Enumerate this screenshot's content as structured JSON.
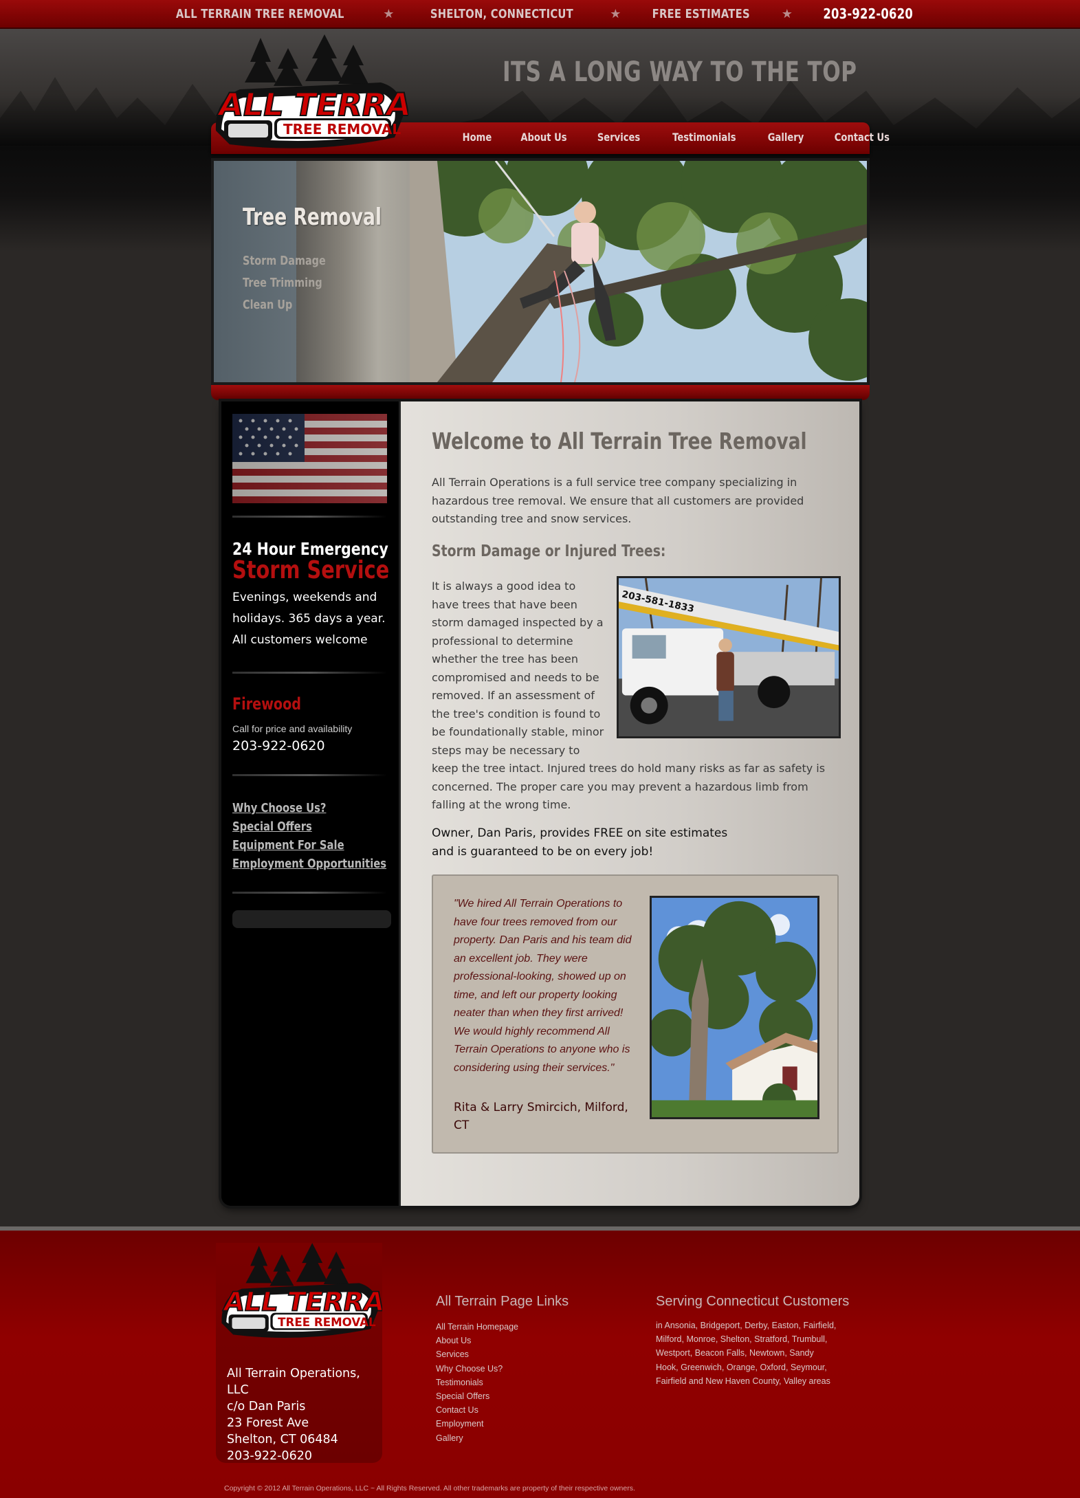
{
  "topbar": {
    "company": "ALL TERRAIN TREE REMOVAL",
    "location": "SHELTON, CONNECTICUT",
    "offer": "FREE ESTIMATES",
    "phone": "203-922-0620",
    "separator": "★"
  },
  "header": {
    "tagline": "ITS A LONG WAY TO THE TOP",
    "logo": {
      "line1": "ALL TERRAIN",
      "line2": "TREE REMOVAL"
    }
  },
  "nav": {
    "items": [
      {
        "label": "Home"
      },
      {
        "label": "About Us"
      },
      {
        "label": "Services"
      },
      {
        "label": "Testimonials"
      },
      {
        "label": "Gallery"
      },
      {
        "label": "Contact Us"
      }
    ]
  },
  "hero": {
    "title": "Tree Removal",
    "list": [
      "Storm Damage",
      "Tree Trimming",
      "Clean Up"
    ]
  },
  "sidebar": {
    "emergency_line1": "24 Hour Emergency",
    "emergency_line2": "Storm Service",
    "emergency_text": "Evenings, weekends and holidays. 365 days a year. All customers welcome",
    "firewood_title": "Firewood",
    "firewood_sub": "Call for price and availability",
    "firewood_phone": "203-922-0620",
    "links": [
      {
        "label": "Why Choose Us?"
      },
      {
        "label": "Special Offers"
      },
      {
        "label": "Equipment For Sale"
      },
      {
        "label": "Employment Opportunities"
      }
    ]
  },
  "content": {
    "welcome": "Welcome to All Terrain Tree Removal",
    "intro": "All Terrain Operations is a full service tree company specializing in hazardous tree removal. We ensure that all customers are provided outstanding tree and snow services.",
    "storm_title": "Storm Damage or Injured Trees:",
    "storm_text": "It is always a good idea to have trees that have been storm damaged inspected by a professional to determine whether the tree has been compromised and needs to be removed. If an assessment of the tree's condition is found to be foundationally stable, minor steps may be necessary to keep the tree intact. Injured trees do hold many risks as far as safety is concerned. The proper care you may prevent a hazardous limb from falling at the wrong time.",
    "truck_phone_text": "203-581-1833",
    "owner_line1": "Owner, Dan Paris, provides FREE on site estimates",
    "owner_line2": "and is guaranteed to be on every job!",
    "testimonial_quote": "\"We hired All Terrain Operations to have four trees removed from our property. Dan Paris and his team did an excellent job. They were professional-looking, showed up on time, and left our property looking neater than when they first arrived! We would highly recommend All Terrain Operations to anyone who is considering using their services.\"",
    "testimonial_author": "Rita & Larry Smircich, Milford, CT"
  },
  "footer": {
    "address": [
      "All Terrain Operations, LLC",
      "c/o Dan Paris",
      "23 Forest Ave",
      "Shelton, CT 06484",
      "203-922-0620"
    ],
    "links_title": "All Terrain Page Links",
    "links": [
      {
        "label": "All Terrain Homepage"
      },
      {
        "label": "About Us"
      },
      {
        "label": "Services"
      },
      {
        "label": "Why Choose Us?"
      },
      {
        "label": "Testimonials"
      },
      {
        "label": "Special Offers"
      },
      {
        "label": "Contact Us"
      },
      {
        "label": "Employment"
      },
      {
        "label": "Gallery"
      }
    ],
    "serving_title": "Serving Connecticut Customers",
    "serving_text": "in Ansonia, Bridgeport, Derby, Easton, Fairfield, Milford, Monroe, Shelton, Stratford, Trumbull, Westport, Beacon Falls, Newtown, Sandy Hook, Greenwich, Orange, Oxford, Seymour, Fairfield and New Haven County, Valley areas",
    "copyright": "Copyright © 2012 All Terrain Operations, LLC ~ All Rights Reserved. All other trademarks are property of their respective owners."
  },
  "colors": {
    "brand_red": "#8a0000",
    "accent_red": "#b40f0f",
    "dark_bg": "#2b2826",
    "content_bg": "#dcd8d3"
  }
}
